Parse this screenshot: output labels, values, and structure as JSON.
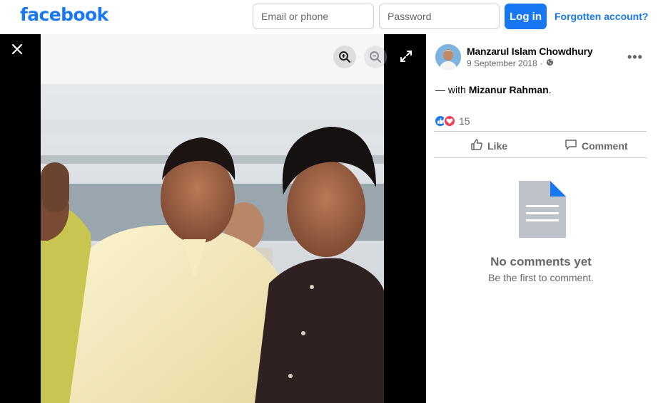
{
  "header": {
    "logo_text": "facebook",
    "email_placeholder": "Email or phone",
    "password_placeholder": "Password",
    "login_label": "Log in",
    "forgot_label": "Forgotten account?"
  },
  "viewer": {
    "close_icon": "close-icon",
    "zoom_in_icon": "zoom-in-icon",
    "zoom_out_icon": "zoom-out-icon",
    "expand_icon": "expand-icon"
  },
  "post": {
    "author": "Manzarul Islam Chowdhury",
    "date": "9 September 2018",
    "separator": "·",
    "privacy_icon": "globe-icon",
    "caption_prefix": "— with ",
    "tagged_name": "Mizanur Rahman",
    "caption_suffix": ".",
    "reaction_count": "15",
    "reaction_icons": [
      "like-icon",
      "love-icon"
    ],
    "like_label": "Like",
    "comment_label": "Comment",
    "empty_title": "No comments yet",
    "empty_subtitle": "Be the first to comment."
  },
  "colors": {
    "brand": "#1877f2",
    "love": "#f33e58",
    "doc": "#bec3c9"
  }
}
